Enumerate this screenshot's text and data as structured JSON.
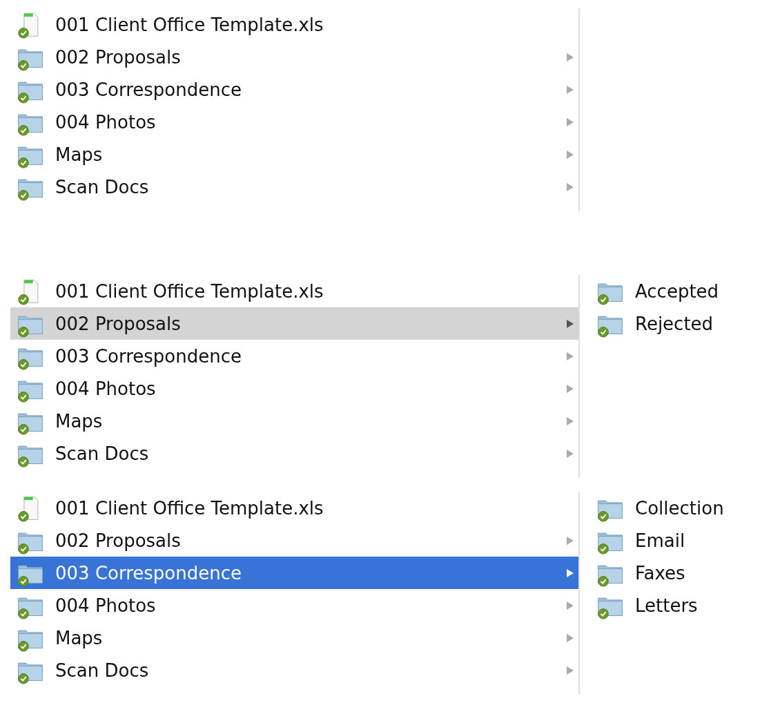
{
  "panels": [
    {
      "items": [
        {
          "kind": "file",
          "name": "001 Client Office Template.xls",
          "selected": false
        },
        {
          "kind": "folder",
          "name": "002 Proposals",
          "selected": false
        },
        {
          "kind": "folder",
          "name": "003 Correspondence",
          "selected": false
        },
        {
          "kind": "folder",
          "name": "004 Photos",
          "selected": false
        },
        {
          "kind": "folder",
          "name": "Maps",
          "selected": false
        },
        {
          "kind": "folder",
          "name": "Scan Docs",
          "selected": false
        }
      ]
    },
    {
      "focused": false,
      "items": [
        {
          "kind": "file",
          "name": "001 Client Office Template.xls",
          "selected": false
        },
        {
          "kind": "folder",
          "name": "002 Proposals",
          "selected": true
        },
        {
          "kind": "folder",
          "name": "003 Correspondence",
          "selected": false
        },
        {
          "kind": "folder",
          "name": "004 Photos",
          "selected": false
        },
        {
          "kind": "folder",
          "name": "Maps",
          "selected": false
        },
        {
          "kind": "folder",
          "name": "Scan Docs",
          "selected": false
        }
      ],
      "children": [
        {
          "kind": "folder",
          "name": "Accepted",
          "selected": false
        },
        {
          "kind": "folder",
          "name": "Rejected",
          "selected": false
        }
      ]
    },
    {
      "focused": true,
      "items": [
        {
          "kind": "file",
          "name": "001 Client Office Template.xls",
          "selected": false
        },
        {
          "kind": "folder",
          "name": "002 Proposals",
          "selected": false
        },
        {
          "kind": "folder",
          "name": "003 Correspondence",
          "selected": true
        },
        {
          "kind": "folder",
          "name": "004 Photos",
          "selected": false
        },
        {
          "kind": "folder",
          "name": "Maps",
          "selected": false
        },
        {
          "kind": "folder",
          "name": "Scan Docs",
          "selected": false
        }
      ],
      "children": [
        {
          "kind": "folder",
          "name": "Collection",
          "selected": false
        },
        {
          "kind": "folder",
          "name": "Email",
          "selected": false
        },
        {
          "kind": "folder",
          "name": "Faxes",
          "selected": false
        },
        {
          "kind": "folder",
          "name": "Letters",
          "selected": false
        }
      ]
    }
  ]
}
